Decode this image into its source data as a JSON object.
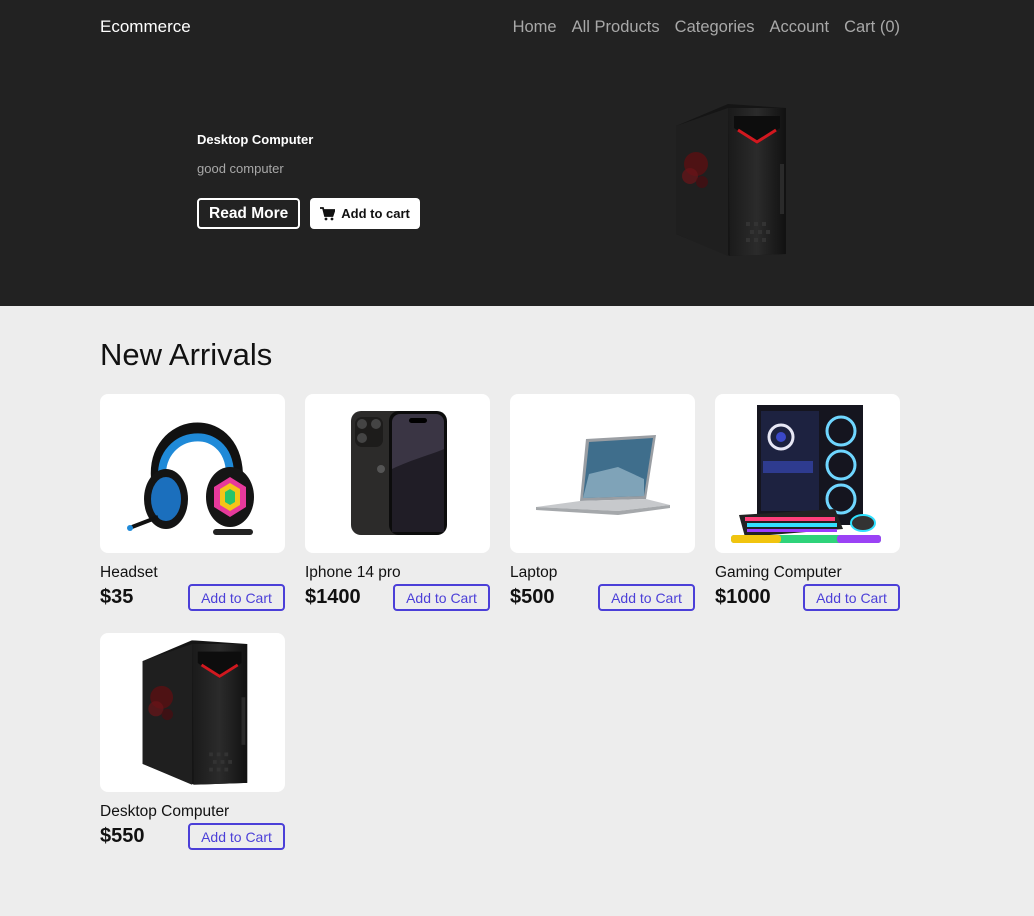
{
  "header": {
    "brand": "Ecommerce",
    "nav": [
      "Home",
      "All Products",
      "Categories",
      "Account",
      "Cart (0)"
    ]
  },
  "hero": {
    "title": "Desktop Computer",
    "description": "good computer",
    "read_more_label": "Read More",
    "add_to_cart_label": "Add to cart"
  },
  "new_arrivals": {
    "title": "New Arrivals",
    "add_to_cart_label": "Add to Cart",
    "products": [
      {
        "name": "Headset",
        "price": "$35",
        "image": "headset"
      },
      {
        "name": "Iphone 14 pro",
        "price": "$1400",
        "image": "phone"
      },
      {
        "name": "Laptop",
        "price": "$500",
        "image": "laptop"
      },
      {
        "name": "Gaming Computer",
        "price": "$1000",
        "image": "gaming-pc"
      },
      {
        "name": "Desktop Computer",
        "price": "$550",
        "image": "desktop-tower"
      }
    ]
  },
  "colors": {
    "hero_bg": "#222222",
    "page_bg": "#ededed",
    "accent": "#4b3fd8"
  }
}
